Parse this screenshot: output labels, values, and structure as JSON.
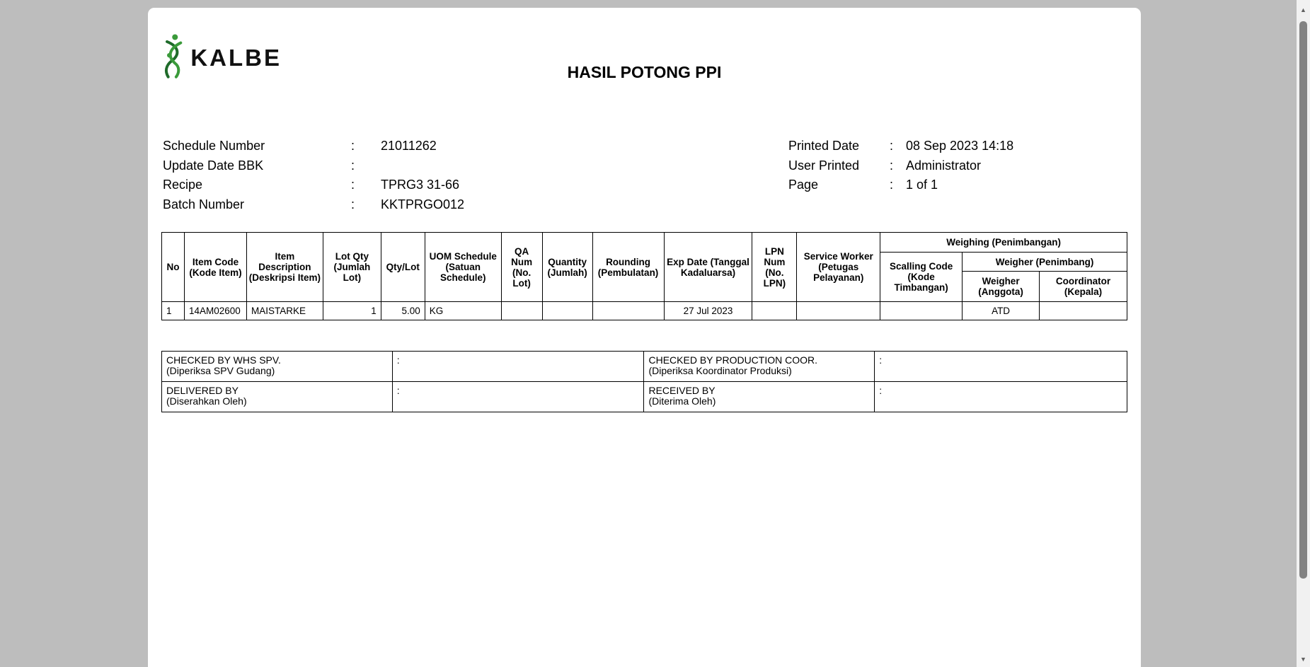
{
  "logo": {
    "text": "KALBE"
  },
  "title": "HASIL POTONG PPI",
  "info_left": [
    {
      "label": "Schedule Number",
      "sep": ":",
      "value": "21011262"
    },
    {
      "label": "Update Date BBK",
      "sep": ":",
      "value": ""
    },
    {
      "label": "Recipe",
      "sep": ":",
      "value": "TPRG3 31-66"
    },
    {
      "label": "Batch Number",
      "sep": ":",
      "value": "KKTPRGO012"
    }
  ],
  "info_right": [
    {
      "label": "Printed Date",
      "sep": ":",
      "value": "08 Sep 2023 14:18"
    },
    {
      "label": "User Printed",
      "sep": ":",
      "value": "Administrator"
    },
    {
      "label": "Page",
      "sep": ":",
      "value": "1 of 1"
    }
  ],
  "table": {
    "headers": {
      "no": "No",
      "item_code": "Item Code (Kode Item)",
      "item_desc": "Item Description (Deskripsi Item)",
      "lot_qty": "Lot Qty (Jumlah Lot)",
      "qty_lot": "Qty/Lot",
      "uom": "UOM Schedule (Satuan Schedule)",
      "qa_num": "QA Num (No. Lot)",
      "quantity": "Quantity (Jumlah)",
      "rounding": "Rounding (Pembulatan)",
      "exp_date": "Exp Date (Tanggal Kadaluarsa)",
      "lpn_num": "LPN Num (No. LPN)",
      "service_worker": "Service Worker (Petugas Pelayanan)",
      "weighing": "Weighing (Penimbangan)",
      "scalling_code": "Scalling Code (Kode Timbangan)",
      "weigher_group": "Weigher (Penimbang)",
      "weigher": "Weigher (Anggota)",
      "coordinator": "Coordinator (Kepala)"
    },
    "rows": [
      {
        "no": "1",
        "item_code": "14AM02600",
        "item_desc": "MAISTARKE",
        "lot_qty": "1",
        "qty_lot": "5.00",
        "uom": "KG",
        "qa_num": "",
        "quantity": "",
        "rounding": "",
        "exp_date": "27 Jul 2023",
        "lpn_num": "",
        "service_worker": "",
        "scalling_code": "",
        "weigher": "ATD",
        "coordinator": ""
      }
    ]
  },
  "signatures": [
    {
      "label1": "CHECKED BY WHS SPV.",
      "label2": "(Diperiksa SPV Gudang)",
      "sep": ":"
    },
    {
      "label1": "CHECKED BY PRODUCTION COOR.",
      "label2": "(Diperiksa Koordinator Produksi)",
      "sep": ":"
    },
    {
      "label1": "DELIVERED BY",
      "label2": "(Diserahkan Oleh)",
      "sep": ":"
    },
    {
      "label1": "RECEIVED BY",
      "label2": "(Diterima Oleh)",
      "sep": ":"
    }
  ],
  "colors": {
    "logo_green": "#3a9a3a",
    "logo_dark_green": "#1f6b2a",
    "background": "#bdbdbd"
  },
  "scrollbar": {
    "up_icon": "▲",
    "down_icon": "▼"
  }
}
